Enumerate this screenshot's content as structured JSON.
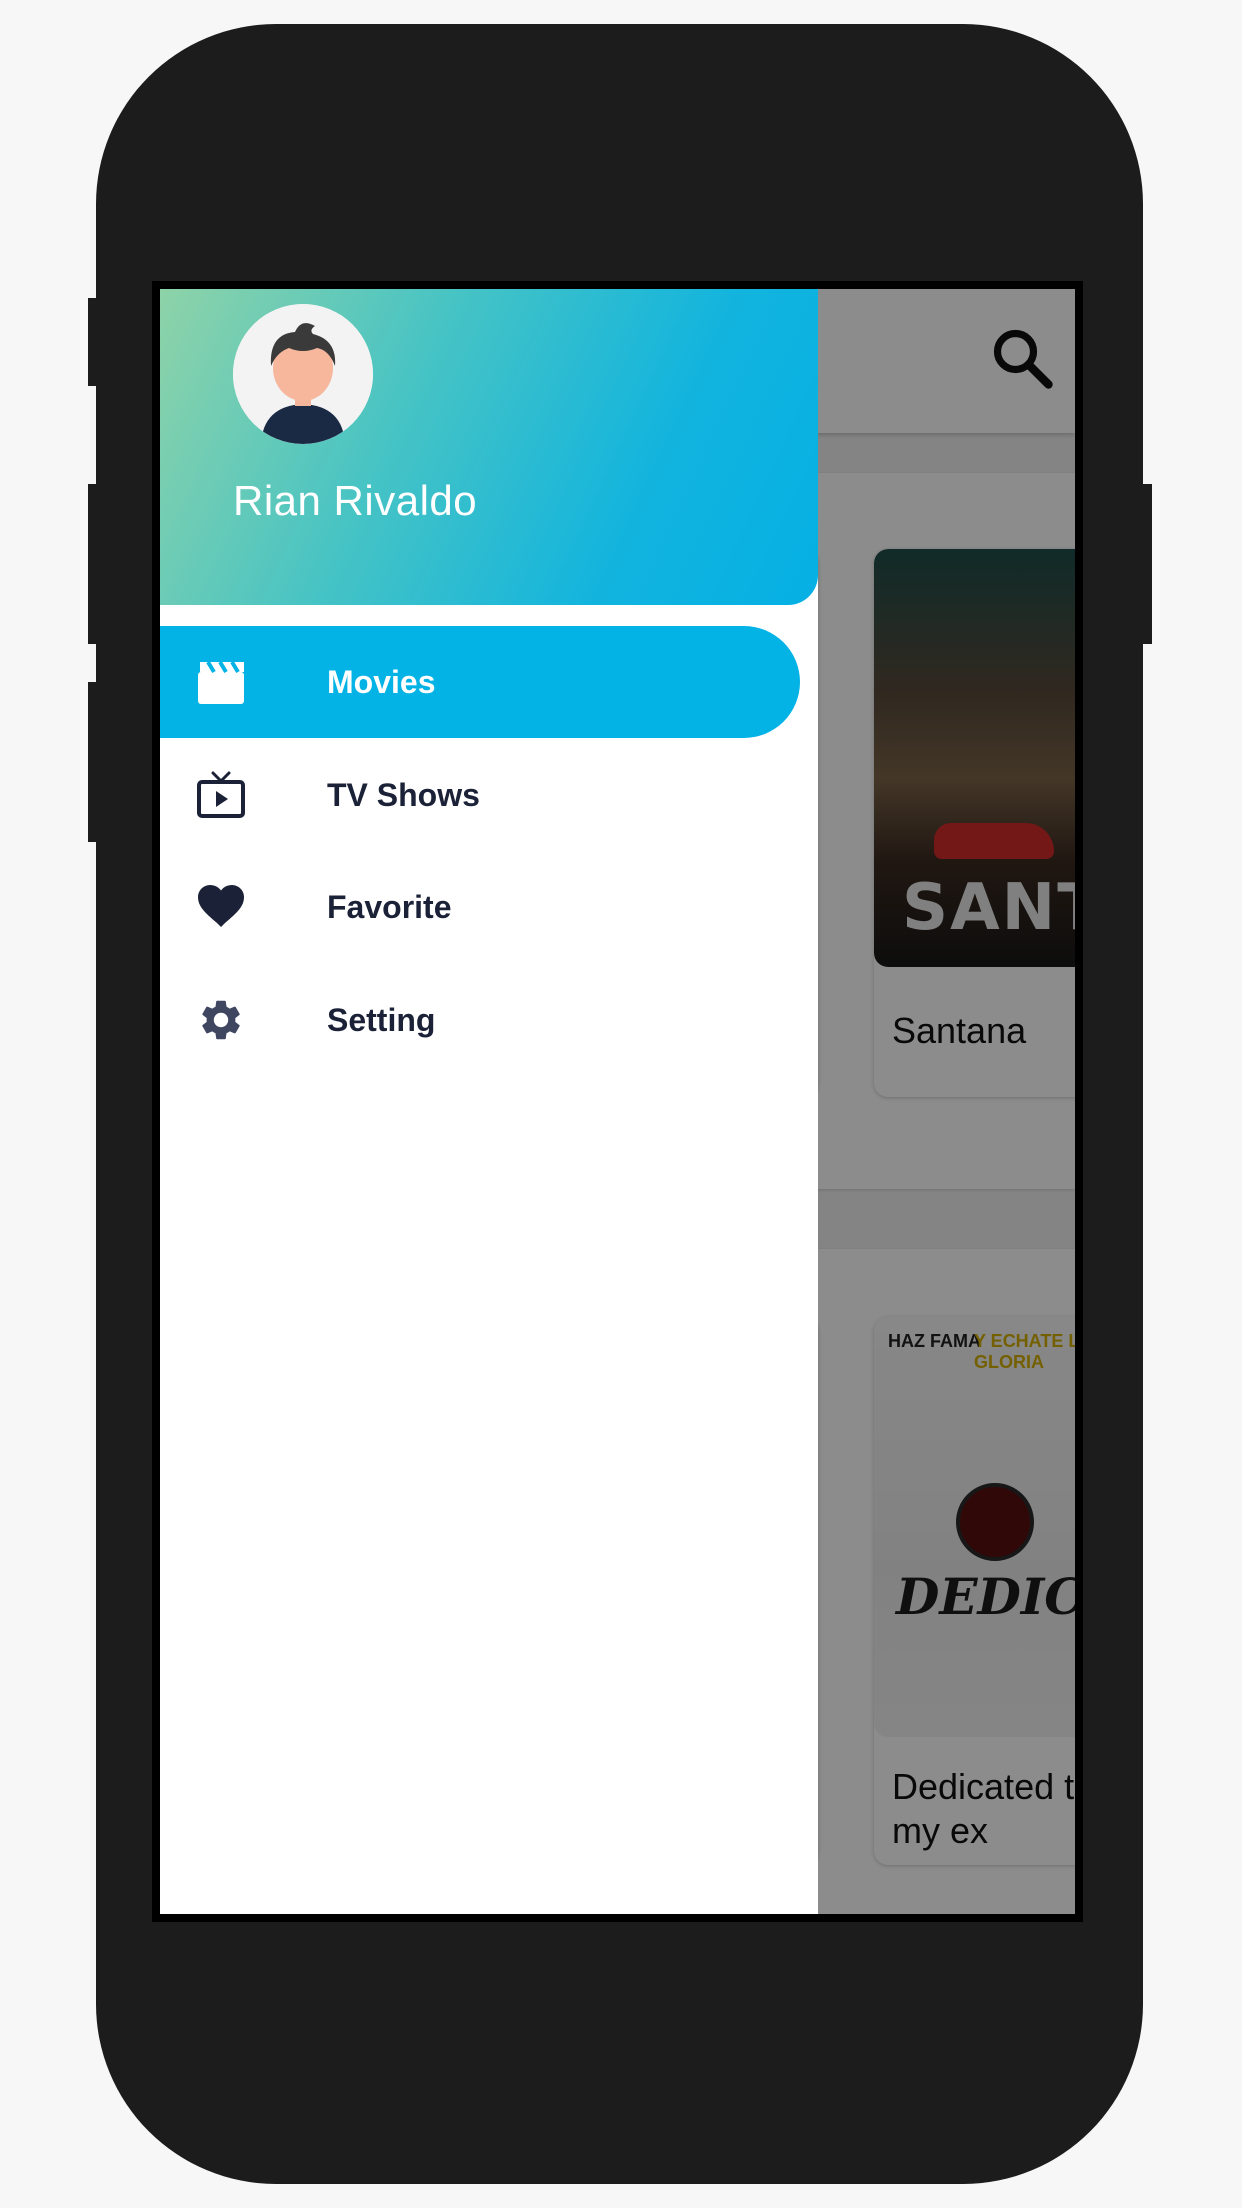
{
  "drawer": {
    "user_name": "Rian Rivaldo",
    "menu": [
      {
        "label": "Movies",
        "icon": "clapperboard-icon",
        "active": true
      },
      {
        "label": "TV Shows",
        "icon": "tv-play-icon",
        "active": false
      },
      {
        "label": "Favorite",
        "icon": "heart-icon",
        "active": false
      },
      {
        "label": "Setting",
        "icon": "gear-icon",
        "active": false
      }
    ]
  },
  "background": {
    "movies": [
      {
        "title": "Santana"
      },
      {
        "title": "Dedicated to my ex"
      }
    ],
    "poster_text": {
      "santana": "SANTANA",
      "dedicated": "DEDICADA A MI EX",
      "dedicated_band_left": "HAZ FAMA",
      "dedicated_band_right": "Y ECHATE LA GLORIA"
    }
  },
  "colors": {
    "accent": "#03b3e6",
    "header_gradient_start": "#8ed3a8",
    "header_gradient_end": "#05b0e4",
    "menu_text": "#1b2237",
    "phone_body": "#1c1c1c"
  }
}
